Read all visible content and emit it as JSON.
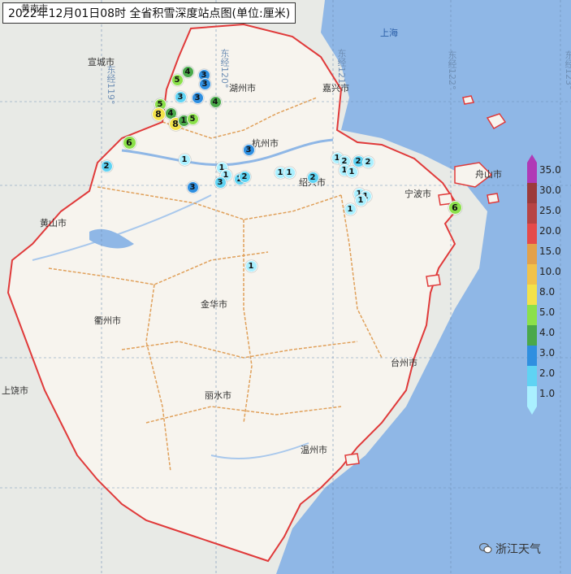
{
  "title": "2022年12月01日08时 全省积雪深度站点图(单位:厘米)",
  "cities": [
    {
      "id": "shanghai",
      "label": "上海"
    },
    {
      "id": "xuancheng",
      "label": "宣城市"
    },
    {
      "id": "huzhou",
      "label": "湖州市"
    },
    {
      "id": "jiaxing",
      "label": "嘉兴市"
    },
    {
      "id": "hangzhou",
      "label": "杭州市"
    },
    {
      "id": "shaoxing",
      "label": "绍兴市"
    },
    {
      "id": "ningbo",
      "label": "宁波市"
    },
    {
      "id": "zhoushan",
      "label": "舟山市"
    },
    {
      "id": "huangshan",
      "label": "黄山市"
    },
    {
      "id": "quzhou",
      "label": "衢州市"
    },
    {
      "id": "jinhua",
      "label": "金华市"
    },
    {
      "id": "taizhou",
      "label": "台州市"
    },
    {
      "id": "lishui",
      "label": "丽水市"
    },
    {
      "id": "shangrao",
      "label": "上饶市"
    },
    {
      "id": "wenzhou",
      "label": "温州市"
    },
    {
      "id": "huangnan",
      "label": "黄南市"
    }
  ],
  "grid_labels": {
    "lon119": "东经119°",
    "lon120": "东经120°",
    "lon121": "东经121°",
    "lon122": "东经122°",
    "lon123": "东经123°"
  },
  "legend": {
    "levels": [
      "35.0",
      "30.0",
      "25.0",
      "20.0",
      "15.0",
      "10.0",
      "8.0",
      "5.0",
      "4.0",
      "3.0",
      "2.0",
      "1.0"
    ],
    "colors": [
      "#b03ab6",
      "#9c3a3a",
      "#b74444",
      "#e54b4b",
      "#e3a14a",
      "#f1c24a",
      "#f3e24a",
      "#8be04a",
      "#4aa84a",
      "#2f8fe0",
      "#5fd3f3",
      "#aaf0ff"
    ]
  },
  "stations": [
    {
      "value": "4",
      "level": "4.0"
    },
    {
      "value": "5",
      "level": "5.0"
    },
    {
      "value": "3",
      "level": "3.0"
    },
    {
      "value": "3",
      "level": "3.0"
    },
    {
      "value": "5",
      "level": "5.0"
    },
    {
      "value": "3",
      "level": "2.0"
    },
    {
      "value": "3",
      "level": "3.0"
    },
    {
      "value": "4",
      "level": "4.0"
    },
    {
      "value": "4",
      "level": "4.0"
    },
    {
      "value": "8",
      "level": "8.0"
    },
    {
      "value": "8",
      "level": "8.0"
    },
    {
      "value": "1",
      "level": "4.0"
    },
    {
      "value": "5",
      "level": "5.0"
    },
    {
      "value": "6",
      "level": "5.0"
    },
    {
      "value": "2",
      "level": "2.0"
    },
    {
      "value": "1",
      "level": "1.0"
    },
    {
      "value": "3",
      "level": "3.0"
    },
    {
      "value": "1",
      "level": "1.0"
    },
    {
      "value": "1",
      "level": "1.0"
    },
    {
      "value": "3",
      "level": "2.0"
    },
    {
      "value": "2",
      "level": "2.0"
    },
    {
      "value": "2",
      "level": "2.0"
    },
    {
      "value": "3",
      "level": "3.0"
    },
    {
      "value": "1",
      "level": "1.0"
    },
    {
      "value": "1",
      "level": "1.0"
    },
    {
      "value": "2",
      "level": "2.0"
    },
    {
      "value": "1",
      "level": "1.0"
    },
    {
      "value": "2",
      "level": "1.0"
    },
    {
      "value": "1",
      "level": "1.0"
    },
    {
      "value": "1",
      "level": "1.0"
    },
    {
      "value": "2",
      "level": "2.0"
    },
    {
      "value": "2",
      "level": "1.0"
    },
    {
      "value": "1",
      "level": "1.0"
    },
    {
      "value": "1",
      "level": "1.0"
    },
    {
      "value": "1",
      "level": "1.0"
    },
    {
      "value": "1",
      "level": "1.0"
    },
    {
      "value": "1",
      "level": "1.0"
    },
    {
      "value": "6",
      "level": "5.0"
    }
  ],
  "watermark": "浙江天气"
}
